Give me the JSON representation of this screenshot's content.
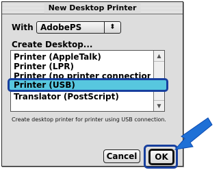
{
  "dialog": {
    "title": "New Desktop Printer",
    "with_label": "With",
    "with_value": "AdobePS",
    "create_label": "Create Desktop...",
    "list_items": [
      "Printer (AppleTalk)",
      "Printer (LPR)",
      "Printer (no printer connection)",
      "Translator (PostScript)"
    ],
    "selected_item": "Printer (USB)",
    "description": "Create desktop printer for printer using USB connection.",
    "cancel_label": "Cancel",
    "ok_label": "OK"
  },
  "icons": {
    "popup": "up-down-arrows-icon",
    "scroll_up": "scroll-up-arrow-icon",
    "scroll_down": "scroll-down-arrow-icon",
    "pointer": "blue-pointer-arrow-icon"
  },
  "colors": {
    "selection_fill": "#57c7df",
    "highlight_border": "#173f9e",
    "pointer_arrow": "#1f70d6"
  }
}
